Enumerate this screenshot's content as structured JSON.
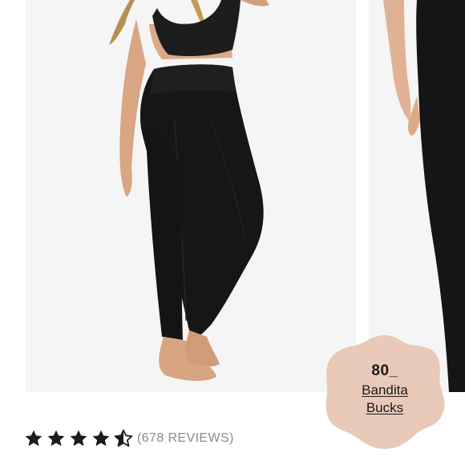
{
  "carousel": {
    "slides": [
      {
        "kind": "product-photo",
        "subject": "model wearing black high-waist leggings"
      },
      {
        "kind": "product-photo",
        "subject": "close-up of black leggings"
      }
    ]
  },
  "rewards_badge": {
    "points": "80_",
    "label_line1": "Bandita",
    "label_line2": "Bucks",
    "color": "#e8c8b8"
  },
  "rating": {
    "value": 4.5,
    "max": 5,
    "star_color": "#1c1c1c",
    "reviews_text": "(678 REVIEWS)"
  }
}
